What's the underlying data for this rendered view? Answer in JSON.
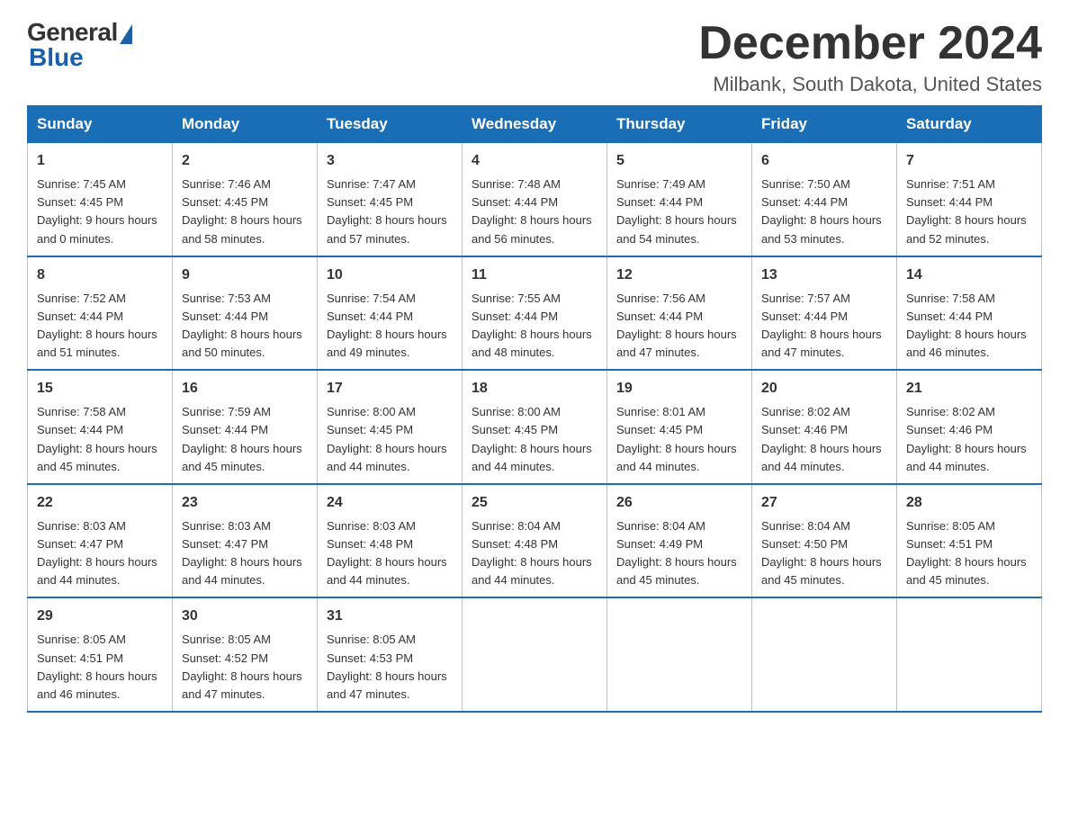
{
  "logo": {
    "general": "General",
    "blue": "Blue"
  },
  "title": "December 2024",
  "location": "Milbank, South Dakota, United States",
  "weekdays": [
    "Sunday",
    "Monday",
    "Tuesday",
    "Wednesday",
    "Thursday",
    "Friday",
    "Saturday"
  ],
  "weeks": [
    [
      {
        "day": "1",
        "sunrise": "7:45 AM",
        "sunset": "4:45 PM",
        "daylight": "9 hours and 0 minutes."
      },
      {
        "day": "2",
        "sunrise": "7:46 AM",
        "sunset": "4:45 PM",
        "daylight": "8 hours and 58 minutes."
      },
      {
        "day": "3",
        "sunrise": "7:47 AM",
        "sunset": "4:45 PM",
        "daylight": "8 hours and 57 minutes."
      },
      {
        "day": "4",
        "sunrise": "7:48 AM",
        "sunset": "4:44 PM",
        "daylight": "8 hours and 56 minutes."
      },
      {
        "day": "5",
        "sunrise": "7:49 AM",
        "sunset": "4:44 PM",
        "daylight": "8 hours and 54 minutes."
      },
      {
        "day": "6",
        "sunrise": "7:50 AM",
        "sunset": "4:44 PM",
        "daylight": "8 hours and 53 minutes."
      },
      {
        "day": "7",
        "sunrise": "7:51 AM",
        "sunset": "4:44 PM",
        "daylight": "8 hours and 52 minutes."
      }
    ],
    [
      {
        "day": "8",
        "sunrise": "7:52 AM",
        "sunset": "4:44 PM",
        "daylight": "8 hours and 51 minutes."
      },
      {
        "day": "9",
        "sunrise": "7:53 AM",
        "sunset": "4:44 PM",
        "daylight": "8 hours and 50 minutes."
      },
      {
        "day": "10",
        "sunrise": "7:54 AM",
        "sunset": "4:44 PM",
        "daylight": "8 hours and 49 minutes."
      },
      {
        "day": "11",
        "sunrise": "7:55 AM",
        "sunset": "4:44 PM",
        "daylight": "8 hours and 48 minutes."
      },
      {
        "day": "12",
        "sunrise": "7:56 AM",
        "sunset": "4:44 PM",
        "daylight": "8 hours and 47 minutes."
      },
      {
        "day": "13",
        "sunrise": "7:57 AM",
        "sunset": "4:44 PM",
        "daylight": "8 hours and 47 minutes."
      },
      {
        "day": "14",
        "sunrise": "7:58 AM",
        "sunset": "4:44 PM",
        "daylight": "8 hours and 46 minutes."
      }
    ],
    [
      {
        "day": "15",
        "sunrise": "7:58 AM",
        "sunset": "4:44 PM",
        "daylight": "8 hours and 45 minutes."
      },
      {
        "day": "16",
        "sunrise": "7:59 AM",
        "sunset": "4:44 PM",
        "daylight": "8 hours and 45 minutes."
      },
      {
        "day": "17",
        "sunrise": "8:00 AM",
        "sunset": "4:45 PM",
        "daylight": "8 hours and 44 minutes."
      },
      {
        "day": "18",
        "sunrise": "8:00 AM",
        "sunset": "4:45 PM",
        "daylight": "8 hours and 44 minutes."
      },
      {
        "day": "19",
        "sunrise": "8:01 AM",
        "sunset": "4:45 PM",
        "daylight": "8 hours and 44 minutes."
      },
      {
        "day": "20",
        "sunrise": "8:02 AM",
        "sunset": "4:46 PM",
        "daylight": "8 hours and 44 minutes."
      },
      {
        "day": "21",
        "sunrise": "8:02 AM",
        "sunset": "4:46 PM",
        "daylight": "8 hours and 44 minutes."
      }
    ],
    [
      {
        "day": "22",
        "sunrise": "8:03 AM",
        "sunset": "4:47 PM",
        "daylight": "8 hours and 44 minutes."
      },
      {
        "day": "23",
        "sunrise": "8:03 AM",
        "sunset": "4:47 PM",
        "daylight": "8 hours and 44 minutes."
      },
      {
        "day": "24",
        "sunrise": "8:03 AM",
        "sunset": "4:48 PM",
        "daylight": "8 hours and 44 minutes."
      },
      {
        "day": "25",
        "sunrise": "8:04 AM",
        "sunset": "4:48 PM",
        "daylight": "8 hours and 44 minutes."
      },
      {
        "day": "26",
        "sunrise": "8:04 AM",
        "sunset": "4:49 PM",
        "daylight": "8 hours and 45 minutes."
      },
      {
        "day": "27",
        "sunrise": "8:04 AM",
        "sunset": "4:50 PM",
        "daylight": "8 hours and 45 minutes."
      },
      {
        "day": "28",
        "sunrise": "8:05 AM",
        "sunset": "4:51 PM",
        "daylight": "8 hours and 45 minutes."
      }
    ],
    [
      {
        "day": "29",
        "sunrise": "8:05 AM",
        "sunset": "4:51 PM",
        "daylight": "8 hours and 46 minutes."
      },
      {
        "day": "30",
        "sunrise": "8:05 AM",
        "sunset": "4:52 PM",
        "daylight": "8 hours and 47 minutes."
      },
      {
        "day": "31",
        "sunrise": "8:05 AM",
        "sunset": "4:53 PM",
        "daylight": "8 hours and 47 minutes."
      },
      null,
      null,
      null,
      null
    ]
  ]
}
